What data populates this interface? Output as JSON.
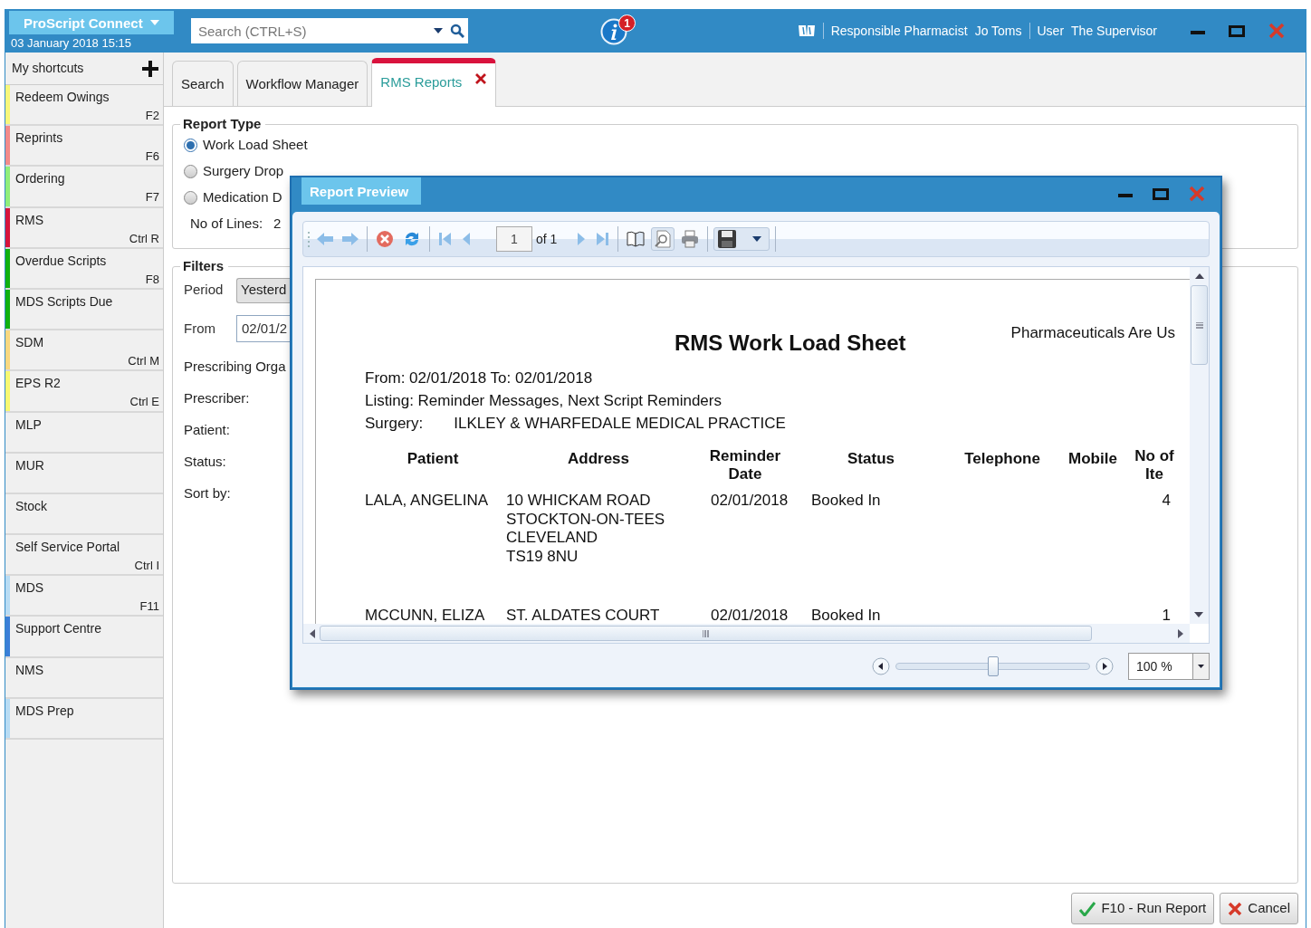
{
  "app": {
    "title": "ProScript Connect",
    "datetime": "03 January 2018 15:15",
    "search": {
      "placeholder": "Search (CTRL+S)"
    },
    "notifications": "1",
    "pharmacist_label": "Responsible Pharmacist",
    "pharmacist": "Jo Toms",
    "user_label": "User",
    "user": "The Supervisor"
  },
  "sidebar": {
    "title": "My shortcuts",
    "items": [
      {
        "label": "Redeem Owings",
        "shortcut": "F2",
        "color": "#f7f77a"
      },
      {
        "label": "Reprints",
        "shortcut": "F6",
        "color": "#f28a8a"
      },
      {
        "label": "Ordering",
        "shortcut": "F7",
        "color": "#90ee7a"
      },
      {
        "label": "RMS",
        "shortcut": "Ctrl R",
        "color": "#d6143c"
      },
      {
        "label": "Overdue Scripts",
        "shortcut": "F8",
        "color": "#10b010"
      },
      {
        "label": "MDS Scripts Due",
        "color": "#10b010"
      },
      {
        "label": "SDM",
        "shortcut": "Ctrl M",
        "color": "#f8d880"
      },
      {
        "label": "EPS R2",
        "shortcut": "Ctrl E",
        "color": "#f8f870"
      },
      {
        "label": "MLP"
      },
      {
        "label": "MUR"
      },
      {
        "label": "Stock"
      },
      {
        "label": "Self Service Portal",
        "shortcut": "Ctrl I"
      },
      {
        "label": "MDS",
        "shortcut": "F11",
        "color": "#b8dcf4"
      },
      {
        "label": "Support Centre",
        "color": "#3a7fd8"
      },
      {
        "label": "NMS"
      },
      {
        "label": "MDS Prep",
        "color": "#b8dcf4"
      }
    ]
  },
  "tabs": [
    {
      "label": "Search",
      "selected": false,
      "closable": false
    },
    {
      "label": "Workflow Manager",
      "selected": false,
      "closable": false
    },
    {
      "label": "RMS Reports",
      "selected": true,
      "closable": true
    }
  ],
  "report_type": {
    "legend": "Report Type",
    "options": [
      {
        "label": "Work Load Sheet",
        "selected": true
      },
      {
        "label": "Surgery Drop",
        "selected": false
      },
      {
        "label": "Medication D",
        "selected": false
      }
    ],
    "lines_label": "No of Lines:",
    "lines_value": "2"
  },
  "filters": {
    "legend": "Filters",
    "period_label": "Period",
    "period_value": "Yesterd",
    "from_label": "From",
    "from_value": "02/01/2",
    "labels": [
      "Prescribing Orga",
      "Prescriber:",
      "Patient:",
      "Status:",
      "Sort by:"
    ]
  },
  "preview": {
    "title": "Report Preview",
    "page": "1",
    "page_count": "of 1",
    "zoom_slider": {
      "level": 0.5
    },
    "zoom": "100 %",
    "report": {
      "title": "RMS Work Load Sheet",
      "company": "Pharmaceuticals Are Us",
      "date_range": "From: 02/01/2018 To: 02/01/2018",
      "listing": "Listing: Reminder Messages, Next Script Reminders",
      "surgery_label": "Surgery:",
      "surgery": "ILKLEY & WHARFEDALE MEDICAL PRACTICE",
      "columns": [
        "Patient",
        "Address",
        "Reminder Date",
        "Status",
        "Telephone",
        "Mobile",
        "No of Ite"
      ],
      "rows": [
        {
          "patient": "LALA, ANGELINA",
          "address": [
            "10 WHICKAM ROAD",
            "STOCKTON-ON-TEES",
            "CLEVELAND",
            "TS19 8NU"
          ],
          "date": "02/01/2018",
          "status": "Booked In",
          "items": "4"
        },
        {
          "patient": "MCCUNN, ELIZA",
          "address": [
            "ST. ALDATES COURT"
          ],
          "date": "02/01/2018",
          "status": "Booked In",
          "items": "1"
        }
      ]
    }
  },
  "buttons": [
    {
      "label": "F10 - Run Report",
      "kind": "confirm"
    },
    {
      "label": "Cancel",
      "kind": "cancel"
    }
  ]
}
